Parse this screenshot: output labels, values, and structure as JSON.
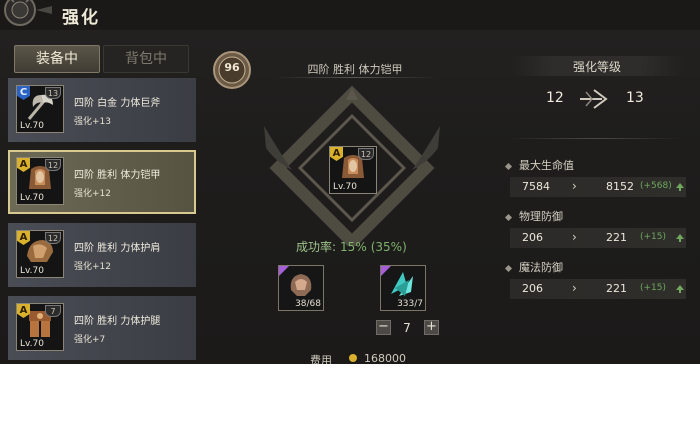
{
  "title": "强化",
  "tabs": {
    "equipped": "装备中",
    "bag": "背包中"
  },
  "equipment_list": [
    {
      "grade": "C",
      "shield_num": "13",
      "level": "Lv.70",
      "name": "四阶 白金 力体巨斧",
      "enhance": "强化+13",
      "selected": false
    },
    {
      "grade": "A",
      "shield_num": "12",
      "level": "Lv.70",
      "name": "四阶 胜利 体力铠甲",
      "enhance": "强化+12",
      "selected": true
    },
    {
      "grade": "A",
      "shield_num": "12",
      "level": "Lv.70",
      "name": "四阶 胜利 力体护肩",
      "enhance": "强化+12",
      "selected": false
    },
    {
      "grade": "A",
      "shield_num": "7",
      "level": "Lv.70",
      "name": "四阶 胜利 力体护腿",
      "enhance": "强化+7",
      "selected": false
    }
  ],
  "center": {
    "badge": "96",
    "item_name": "四阶 胜利 体力铠甲",
    "item_grade": "A",
    "item_shield_num": "12",
    "item_level": "Lv.70",
    "success_label": "成功率:",
    "success_rate": "15%",
    "success_bonus": "(35%)",
    "materials": [
      {
        "name": "armor-material-icon",
        "count": "38/68"
      },
      {
        "name": "crystal-material-icon",
        "count": "333/7"
      }
    ],
    "quantity": "7",
    "cost_label": "费用",
    "cost_value": "168000"
  },
  "enhance_level": {
    "label": "强化等级",
    "from": "12",
    "to": "13"
  },
  "stats": [
    {
      "label": "最大生命值",
      "from": "7584",
      "to": "8152",
      "diff": "(+568)"
    },
    {
      "label": "物理防御",
      "from": "206",
      "to": "221",
      "diff": "(+15)"
    },
    {
      "label": "魔法防御",
      "from": "206",
      "to": "221",
      "diff": "(+15)"
    }
  ],
  "colors": {
    "success_green": "#7fb26c",
    "selected_border": "#d9c98e",
    "grade_a": "#d9b12c",
    "grade_c": "#2a63c4",
    "material_corner": "#a65fd6"
  }
}
